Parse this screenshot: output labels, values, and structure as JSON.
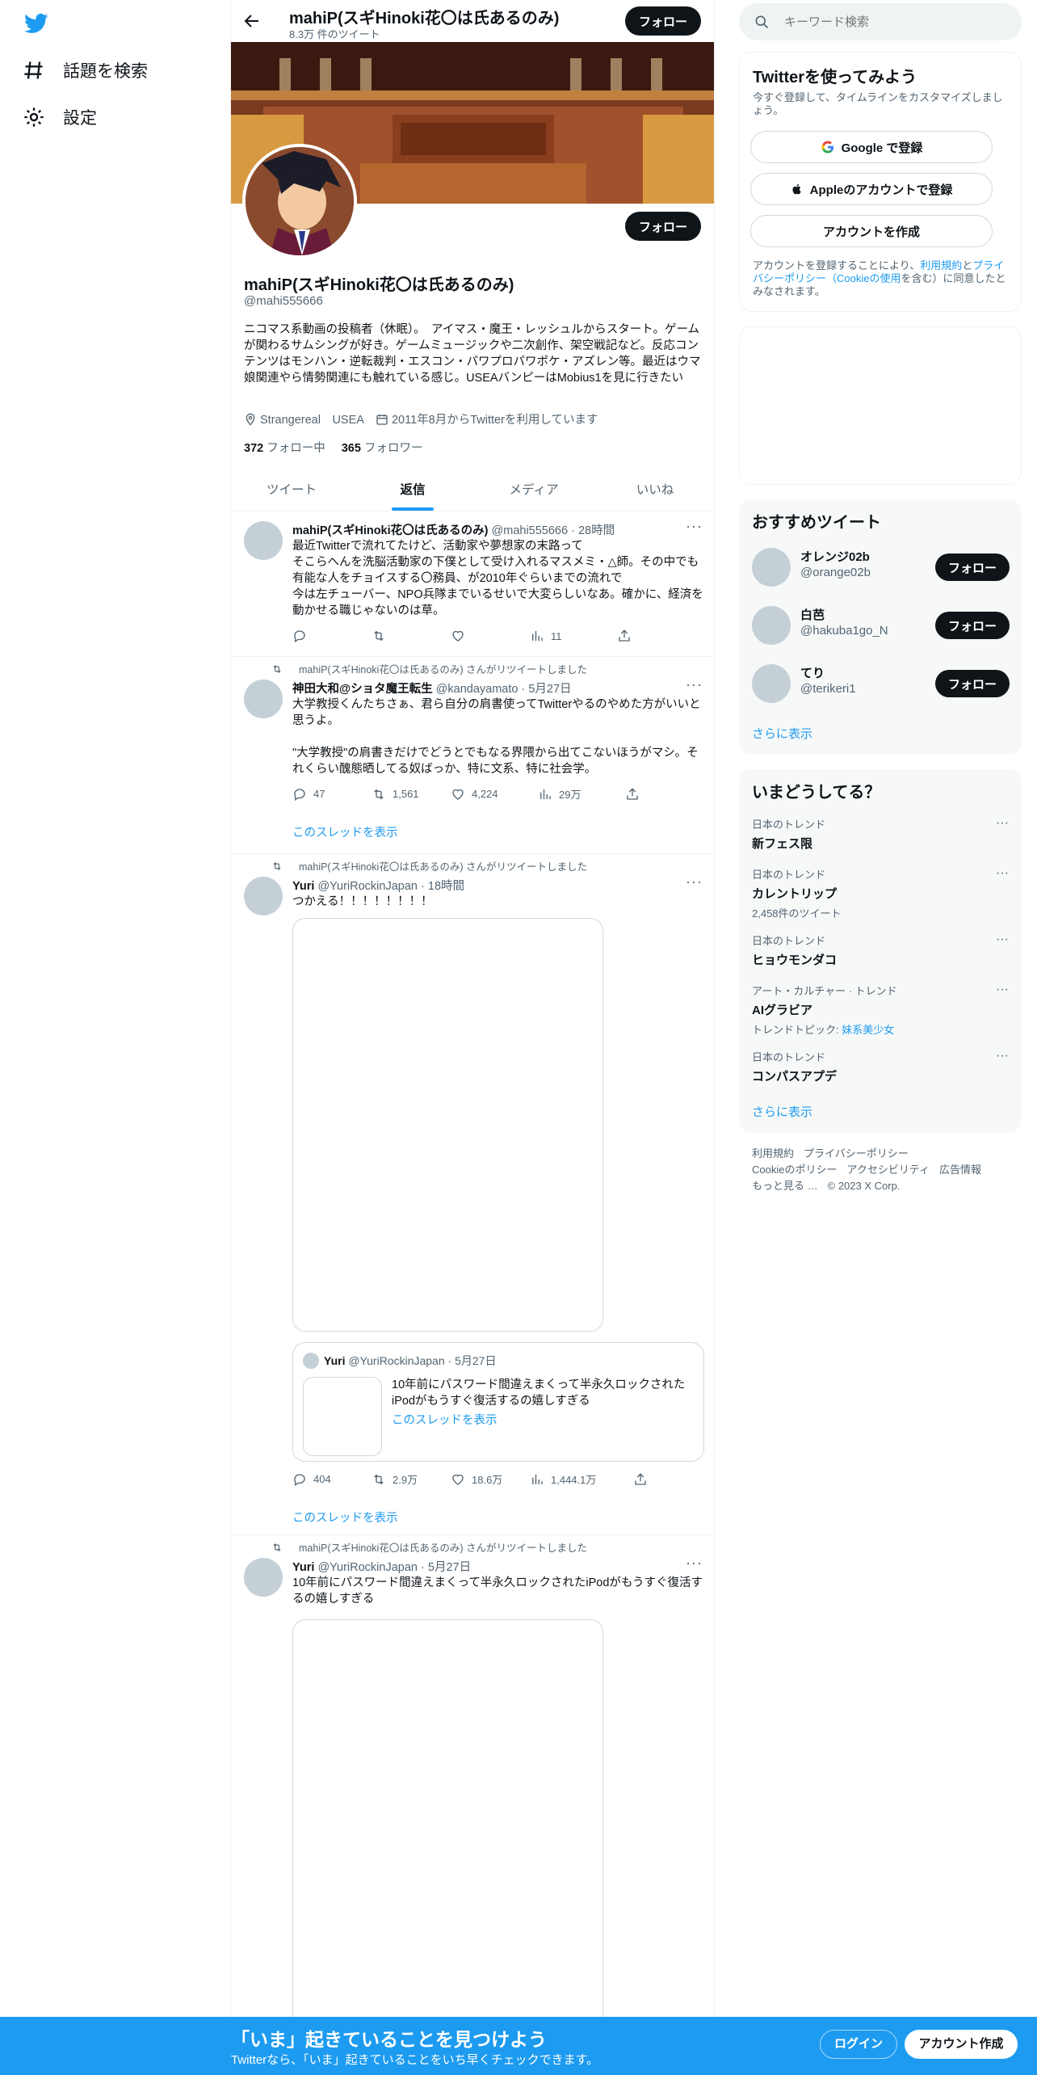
{
  "nav": {
    "explore_label": "話題を検索",
    "settings_label": "設定"
  },
  "header": {
    "title": "mahiP(スギHinoki花〇は氏あるのみ)",
    "tweet_count": "8.3万 件のツイート",
    "follow_label": "フォロー"
  },
  "profile": {
    "name": "mahiP(スギHinoki花〇は氏あるのみ)",
    "handle": "@mahi555666",
    "bio": "ニコマス系動画の投稿者（休眠）。　アイマス・魔王・レッシュルからスタート。ゲームが関わるサムシングが好き。ゲームミュージックや二次創作、架空戦記など。反応コンテンツはモンハン・逆転裁判・エスコン・パワプロパワポケ・アズレン等。最近はウマ娘関連やら情勢関連にも触れている感じ。USEAバンピーはMobius1を見に行きたい",
    "location": "Strangereal　USEA",
    "joined": "2011年8月からTwitterを利用しています",
    "following_count": "372",
    "following_label": "フォロー中",
    "followers_count": "365",
    "followers_label": "フォロワー",
    "follow_label": "フォロー"
  },
  "tabs": [
    "ツイート",
    "返信",
    "メディア",
    "いいね"
  ],
  "tweets": [
    {
      "name": "mahiP(スギHinoki花〇は氏あるのみ)",
      "handle": "@mahi555666",
      "time": "28時間",
      "text": "最近Twitterで流れてたけど、活動家や夢想家の末路って\nそこらへんを洗脳活動家の下僕として受け入れるマスメミ・△師。その中でも有能な人をチョイスする〇務員、が2010年ぐらいまでの流れで\n今は左チューバー、NPO兵隊までいるせいで大変らしいなあ。確かに、経済を動かせる職じゃないのは草。",
      "reply": "",
      "retweet": "",
      "like": "",
      "views": "11"
    },
    {
      "retweeted_by": "mahiP(スギHinoki花〇は氏あるのみ) さんがリツイートしました",
      "name": "神田大和@ショタ魔王転生",
      "handle": "@kandayamato",
      "time": "5月27日",
      "text": "大学教授くんたちさぁ、君ら自分の肩書使ってTwitterやるのやめた方がいいと思うよ。\n\n\"大学教授\"の肩書きだけでどうとでもなる界隈から出てこないほうがマシ。それくらい醜態晒してる奴ばっか、特に文系、特に社会学。",
      "reply": "47",
      "retweet": "1,561",
      "like": "4,224",
      "views": "29万",
      "show_thread": "このスレッドを表示"
    },
    {
      "retweeted_by": "mahiP(スギHinoki花〇は氏あるのみ) さんがリツイートしました",
      "name": "Yuri",
      "handle": "@YuriRockinJapan",
      "time": "18時間",
      "text": "つかえる！！！！！！！！",
      "quote": {
        "name": "Yuri",
        "handle": "@YuriRockinJapan",
        "time": "5月27日",
        "text": "10年前にパスワード間違えまくって半永久ロックされたiPodがもうすぐ復活するの嬉しすぎる",
        "show_thread": "このスレッドを表示"
      },
      "reply": "404",
      "retweet": "2.9万",
      "like": "18.6万",
      "views": "1,444.1万",
      "show_thread": "このスレッドを表示"
    },
    {
      "retweeted_by": "mahiP(スギHinoki花〇は氏あるのみ) さんがリツイートしました",
      "name": "Yuri",
      "handle": "@YuriRockinJapan",
      "time": "5月27日",
      "text": "10年前にパスワード間違えまくって半永久ロックされたiPodがもうすぐ復活するの嬉しすぎる"
    }
  ],
  "search": {
    "placeholder": "キーワード検索"
  },
  "signup": {
    "title": "Twitterを使ってみよう",
    "subtitle": "今すぐ登録して、タイムラインをカスタマイズしましょう。",
    "google": "Google で登録",
    "apple": "Appleのアカウントで登録",
    "create": "アカウントを作成",
    "terms_pre": "アカウントを登録することにより、",
    "terms_link": "利用規約",
    "terms_mid": "と",
    "privacy_link": "プライバシーポリシー",
    "cookie_pre": "（",
    "cookie_link": "Cookieの使用",
    "terms_post": "を含む）に同意したとみなされます。"
  },
  "who_to_follow": {
    "title": "おすすめツイート",
    "users": [
      {
        "name": "オレンジ02b",
        "handle": "@orange02b",
        "button": "フォロー"
      },
      {
        "name": "白芭",
        "handle": "@hakuba1go_N",
        "button": "フォロー"
      },
      {
        "name": "てり",
        "handle": "@terikeri1",
        "button": "フォロー"
      }
    ],
    "show_more": "さらに表示"
  },
  "trends": {
    "title": "いまどうしてる？",
    "items": [
      {
        "context": "日本のトレンド",
        "title": "新フェス限",
        "extra": ""
      },
      {
        "context": "日本のトレンド",
        "title": "カレントリップ",
        "extra": "2,458件のツイート"
      },
      {
        "context": "日本のトレンド",
        "title": "ヒョウモンダコ",
        "extra": ""
      },
      {
        "context": "アート・カルチャー · トレンド",
        "title": "AIグラビア",
        "extra": "トレンドトピック: ",
        "extra_link": "妹系美少女"
      },
      {
        "context": "日本のトレンド",
        "title": "コンパスアプデ",
        "extra": ""
      }
    ],
    "show_more": "さらに表示"
  },
  "footer": {
    "links": [
      "利用規約",
      "プライバシーポリシー",
      "Cookieのポリシー",
      "アクセシビリティ",
      "広告情報",
      "もっと見る …",
      "© 2023 X Corp."
    ]
  },
  "bottom_bar": {
    "title": "「いま」起きていることを見つけよう",
    "subtitle": "Twitterなら、「いま」起きていることをいち早くチェックできます。",
    "login": "ログイン",
    "signup": "アカウント作成"
  },
  "colors": {
    "accent": "#1d9bf0",
    "text": "#0f1419",
    "secondary": "#536471"
  },
  "icons": [
    "twitter-logo-icon",
    "hashtag-icon",
    "gear-icon",
    "back-arrow-icon",
    "search-icon",
    "location-icon",
    "calendar-icon",
    "reply-icon",
    "retweet-icon",
    "like-icon",
    "views-icon",
    "share-icon",
    "more-icon",
    "google-icon",
    "apple-icon"
  ]
}
